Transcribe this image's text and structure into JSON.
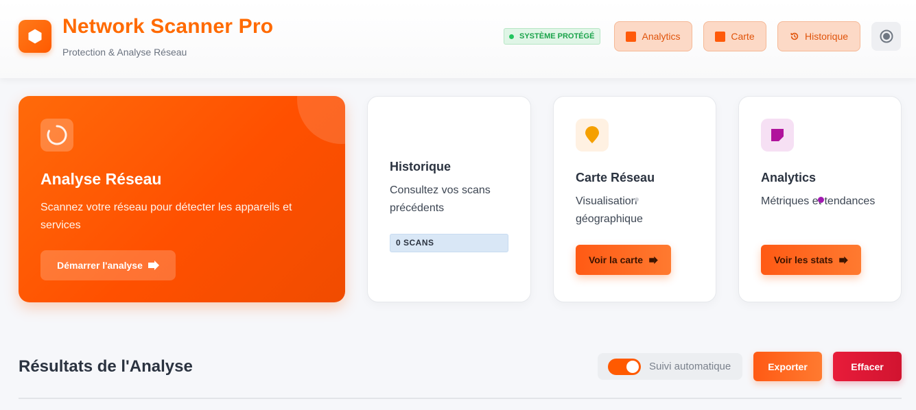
{
  "header": {
    "app_title": "Network Scanner Pro",
    "app_subtitle": "Protection & Analyse Réseau",
    "status_badge": "SYSTÈME PROTÉGÉ",
    "nav": {
      "analytics": "Analytics",
      "carte": "Carte",
      "historique": "Historique"
    },
    "logo_icon": "hexagon-icon",
    "theme_icon": "theme-toggle-icon"
  },
  "cards": {
    "scan": {
      "title": "Analyse Réseau",
      "description": "Scannez votre réseau pour détecter les appareils et services",
      "button": "Démarrer l'analyse",
      "icon": "spinner-icon"
    },
    "history": {
      "title": "Historique",
      "description": "Consultez vos scans précédents",
      "badge": "0 SCANS"
    },
    "map": {
      "title": "Carte Réseau",
      "description": "Visualisation géographique",
      "button": "Voir la carte",
      "icon": "map-pin-icon"
    },
    "stats": {
      "title": "Analytics",
      "description": "Métriques et tendances",
      "button": "Voir les stats",
      "icon": "chart-icon"
    }
  },
  "results": {
    "title": "Résultats de l'Analyse",
    "auto_follow_label": "Suivi automatique",
    "auto_follow_enabled": true,
    "export_button": "Exporter",
    "clear_button": "Effacer"
  },
  "colors": {
    "brand": "#ff6a00",
    "success": "#22c55e",
    "danger": "#e81c3a"
  }
}
